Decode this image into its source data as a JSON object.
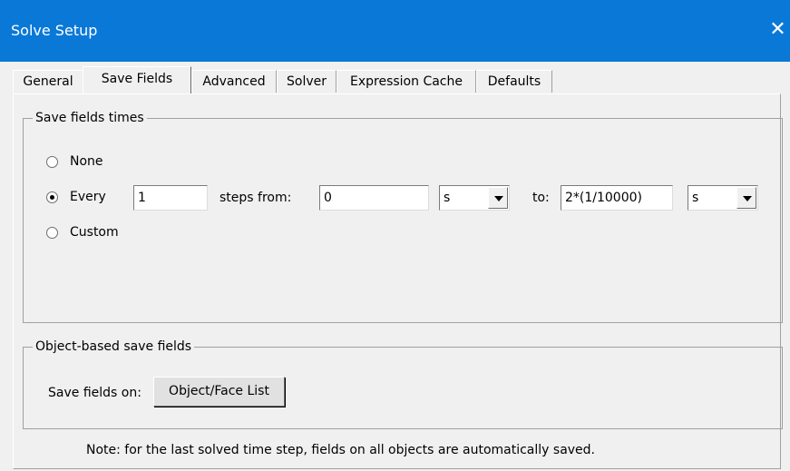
{
  "window": {
    "title": "Solve Setup",
    "close_glyph": "✕"
  },
  "tabs": [
    {
      "label": "General"
    },
    {
      "label": "Save Fields"
    },
    {
      "label": "Advanced"
    },
    {
      "label": "Solver"
    },
    {
      "label": "Expression Cache"
    },
    {
      "label": "Defaults"
    }
  ],
  "active_tab": "Save Fields",
  "save_fields_times": {
    "group_label": "Save fields times",
    "options": {
      "none": "None",
      "every": "Every",
      "custom": "Custom"
    },
    "selected": "Every",
    "every_value": "1",
    "steps_from_label": "steps from:",
    "from_value": "0",
    "from_unit": "s",
    "to_label": "to:",
    "to_value": "2*(1/10000)",
    "to_unit": "s"
  },
  "object_based": {
    "group_label": "Object-based save fields",
    "save_on_label": "Save fields on:",
    "button_label": "Object/Face List"
  },
  "note": "Note: for the last solved time step, fields on all objects are automatically saved."
}
